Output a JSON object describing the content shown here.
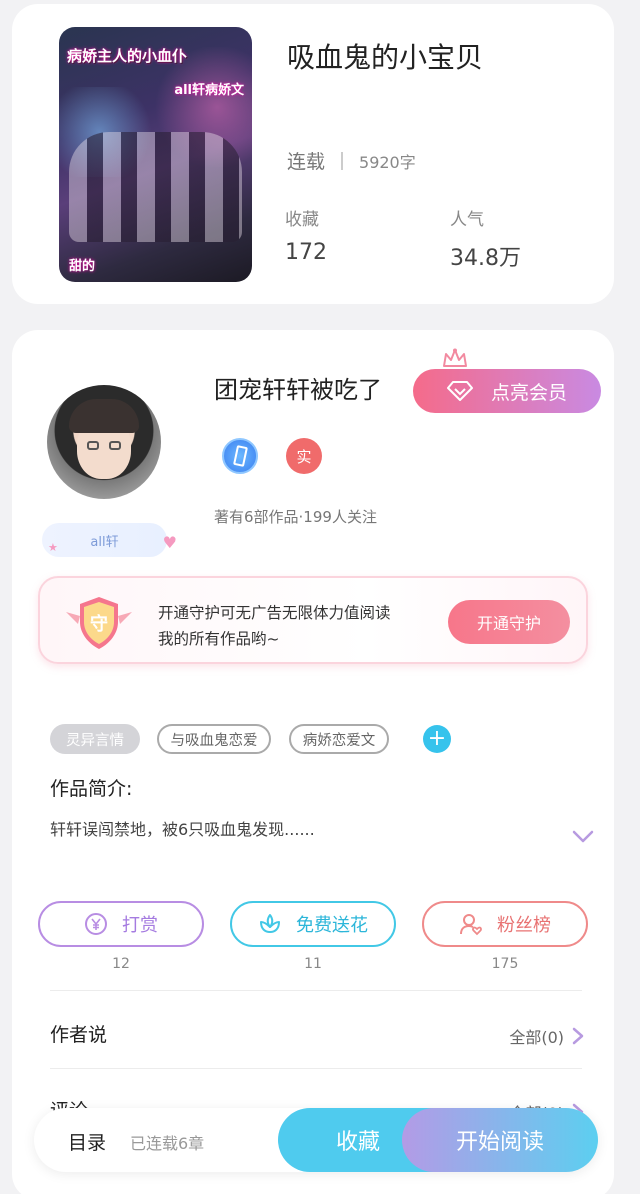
{
  "book": {
    "cover_text_1": "病娇主人的小血仆",
    "cover_text_2": "all轩病娇文",
    "cover_text_3": "甜的",
    "title": "吸血鬼的小宝贝",
    "status": "连载",
    "word_count": "5920字",
    "collect_label": "收藏",
    "collect_value": "172",
    "popularity_label": "人气",
    "popularity_value": "34.8万"
  },
  "author": {
    "name": "团宠轩轩被吃了",
    "vip_button": "点亮会员",
    "badge_real": "实",
    "stats": "著有6部作品·199人关注",
    "tag": "all轩"
  },
  "guard": {
    "icon_char": "守",
    "line1": "开通守护可无广告无限体力值阅读",
    "line2": "我的所有作品哟~",
    "button": "开通守护"
  },
  "tags": [
    "灵异言情",
    "与吸血鬼恋爱",
    "病娇恋爱文"
  ],
  "tag_add": "+",
  "intro": {
    "label": "作品简介:",
    "text": "轩轩误闯禁地，被6只吸血鬼发现......"
  },
  "actions": [
    {
      "label": "打赏",
      "count": "12",
      "icon": "yen-coin-icon"
    },
    {
      "label": "免费送花",
      "count": "11",
      "icon": "flower-icon"
    },
    {
      "label": "粉丝榜",
      "count": "175",
      "icon": "user-heart-icon"
    }
  ],
  "author_says": {
    "title": "作者说",
    "more": "全部(0)"
  },
  "comments": {
    "title": "评论",
    "more": "全部(0)"
  },
  "bottom": {
    "toc": "目录",
    "serial": "已连载6章",
    "collect": "收藏",
    "read": "开始阅读"
  },
  "colors": {
    "accent_blue": "#4fcbee",
    "accent_pink": "#f56b8a",
    "accent_purple": "#b39be6"
  }
}
